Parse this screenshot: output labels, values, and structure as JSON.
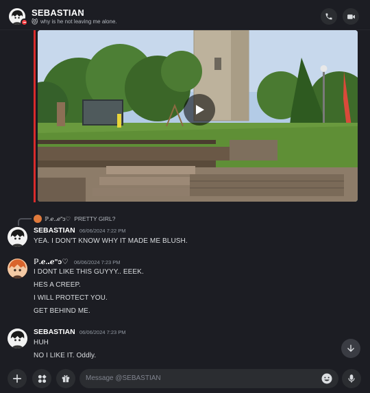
{
  "header": {
    "name": "SEBASTIAN",
    "chevron": "›",
    "status_emoji": "😾",
    "status_text": "why is he not leaving me alone."
  },
  "embed": {
    "accent_color": "#da2b2b",
    "type": "video"
  },
  "reply": {
    "author": "ℙ.ℯ.ꓸℯ\"ↄ♡",
    "text": "PRETTY GIRL?"
  },
  "messages": [
    {
      "author": "SEBASTIAN",
      "time": "06/06/2024 7:22 PM",
      "lines": [
        "YEA. I DON'T KNOW WHY IT MADE ME BLUSH."
      ]
    },
    {
      "author": "ℙ.ℯ.ꓸℯ\"ↄ♡",
      "time": "06/06/2024 7:23 PM",
      "lines": [
        "I DONT LIKE THIS GUYYY.. EEEK.",
        "HES A CREEP.",
        "I WILL PROTECT YOU.",
        "GET BEHIND ME."
      ]
    },
    {
      "author": "SEBASTIAN",
      "time": "06/06/2024 7:23 PM",
      "lines": [
        "HUH",
        "NO I LIKE IT. Oddly."
      ]
    }
  ],
  "composer": {
    "placeholder": "Message @SEBASTIAN"
  },
  "icons": {
    "call": "phone-icon",
    "video": "video-camera-icon",
    "plus": "plus-icon",
    "apps": "apps-icon",
    "gift": "gift-icon",
    "emoji": "emoji-icon",
    "mic": "microphone-icon",
    "scroll": "arrow-down-icon"
  }
}
